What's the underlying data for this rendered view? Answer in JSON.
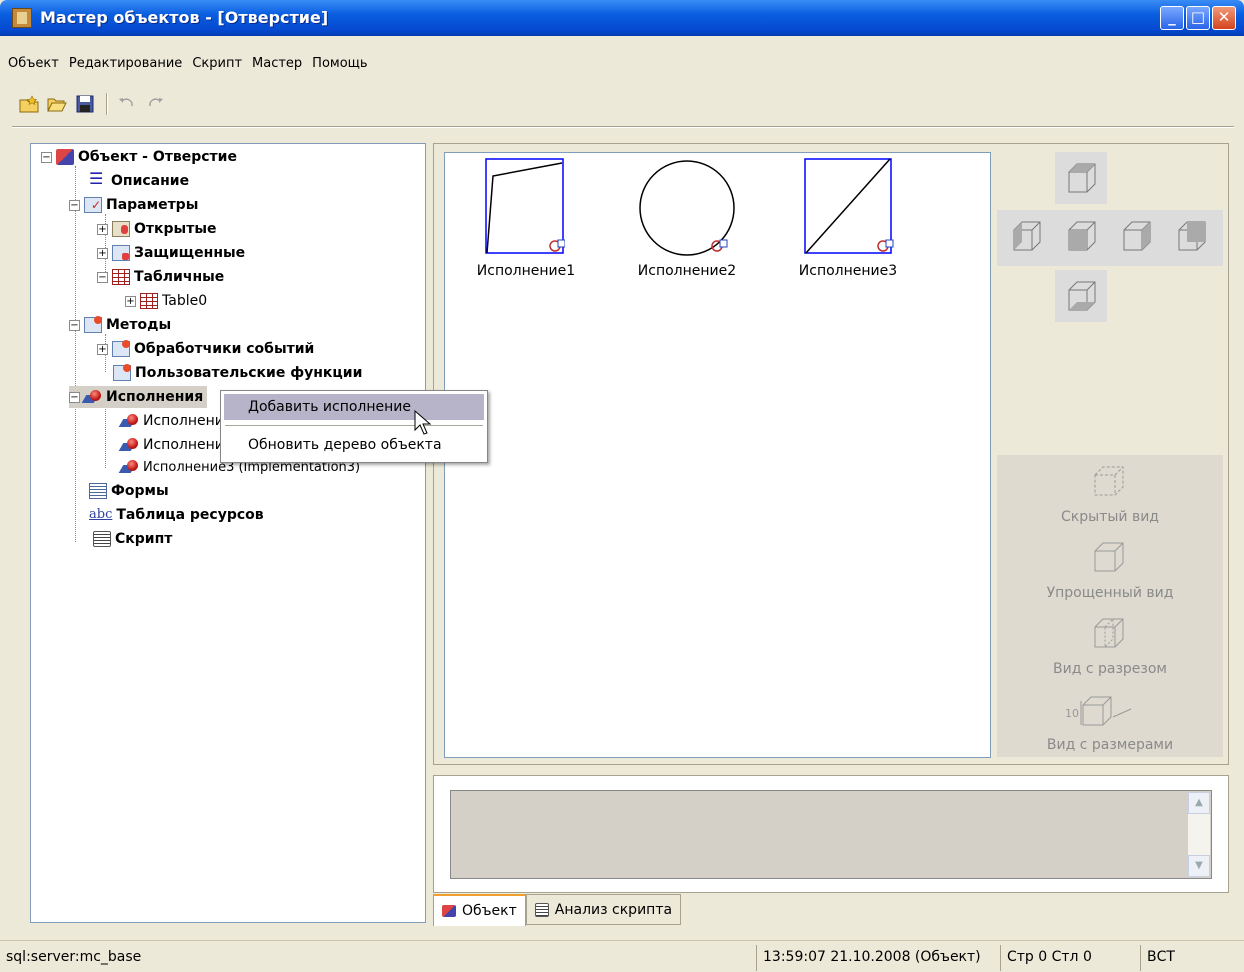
{
  "window": {
    "title": "Мастер объектов - [Отверстие]",
    "min_label": "_",
    "max_label": "□",
    "close_label": "✕"
  },
  "menu": [
    "Объект",
    "Редактирование",
    "Скрипт",
    "Мастер",
    "Помощь"
  ],
  "toolbar": {
    "icons": [
      "new-object-icon",
      "open-folder-icon",
      "save-icon",
      "undo-icon",
      "redo-icon"
    ]
  },
  "tree": {
    "root": "Объект - Отверстие",
    "description": "Описание",
    "parameters": "Параметры",
    "open": "Открытые",
    "protected": "Защищенные",
    "tabular": "Табличные",
    "table0": "Table0",
    "methods": "Методы",
    "event_handlers": "Обработчики событий",
    "user_functions": "Пользовательские функции",
    "implementations": "Исполнения",
    "impl1": "Исполнение1 (Implementation1)",
    "impl2": "Исполнение2 (Implementation2)",
    "impl3": "Исполнение3 (Implementation3)",
    "forms": "Формы",
    "resources": "Таблица ресурсов",
    "script": "Скрипт",
    "abc_icon_text": "abc"
  },
  "context_menu": {
    "add": "Добавить исполнение",
    "refresh": "Обновить дерево объекта"
  },
  "canvas": {
    "implementations": [
      "Исполнение1",
      "Исполнение2",
      "Исполнение3"
    ]
  },
  "views": {
    "hidden": "Скрытый вид",
    "simplified": "Упрощенный вид",
    "section": "Вид с разрезом",
    "dimensions": "Вид с размерами",
    "dim_num": "10"
  },
  "tabs": {
    "object": "Объект",
    "script_analysis": "Анализ скрипта"
  },
  "status": {
    "server": "sql:server:mc_base",
    "datetime": "13:59:07  21.10.2008  (Объект)",
    "position": "Стр 0 Стл 0",
    "mode": "ВСТ"
  }
}
